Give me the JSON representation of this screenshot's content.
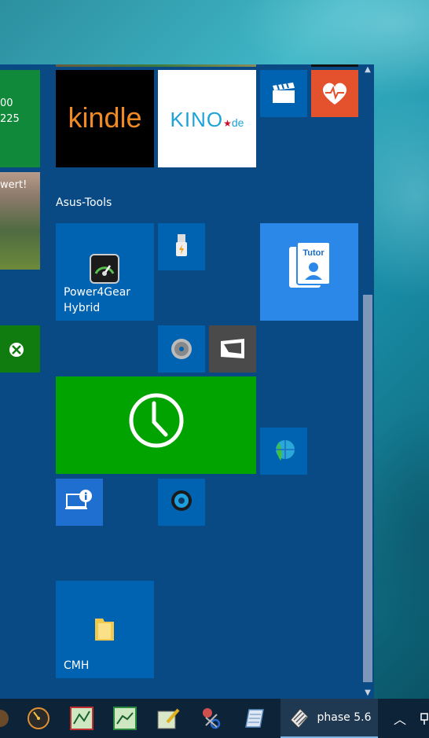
{
  "tiles": {
    "kindle": {
      "text": "kindle"
    },
    "kino": {
      "text_main": "KINO",
      "text_suffix": "de"
    },
    "asus_group_title": "Asus-Tools",
    "power4gear": {
      "label": "Power4Gear\nHybrid"
    },
    "tutor": {
      "text": "Tutor"
    },
    "cmh": {
      "label": "CMH"
    }
  },
  "partial_tiles": {
    "numbers_line1": "00",
    "numbers_line2": "225",
    "photo_text": "wert!"
  },
  "taskbar": {
    "active_app_label": "phase 5.6"
  },
  "colors": {
    "panel": "#0a4a84",
    "tile_blue": "#0063b1",
    "tile_green": "#00a300",
    "tile_red": "#e3512d",
    "taskbar": "#0d2338"
  }
}
